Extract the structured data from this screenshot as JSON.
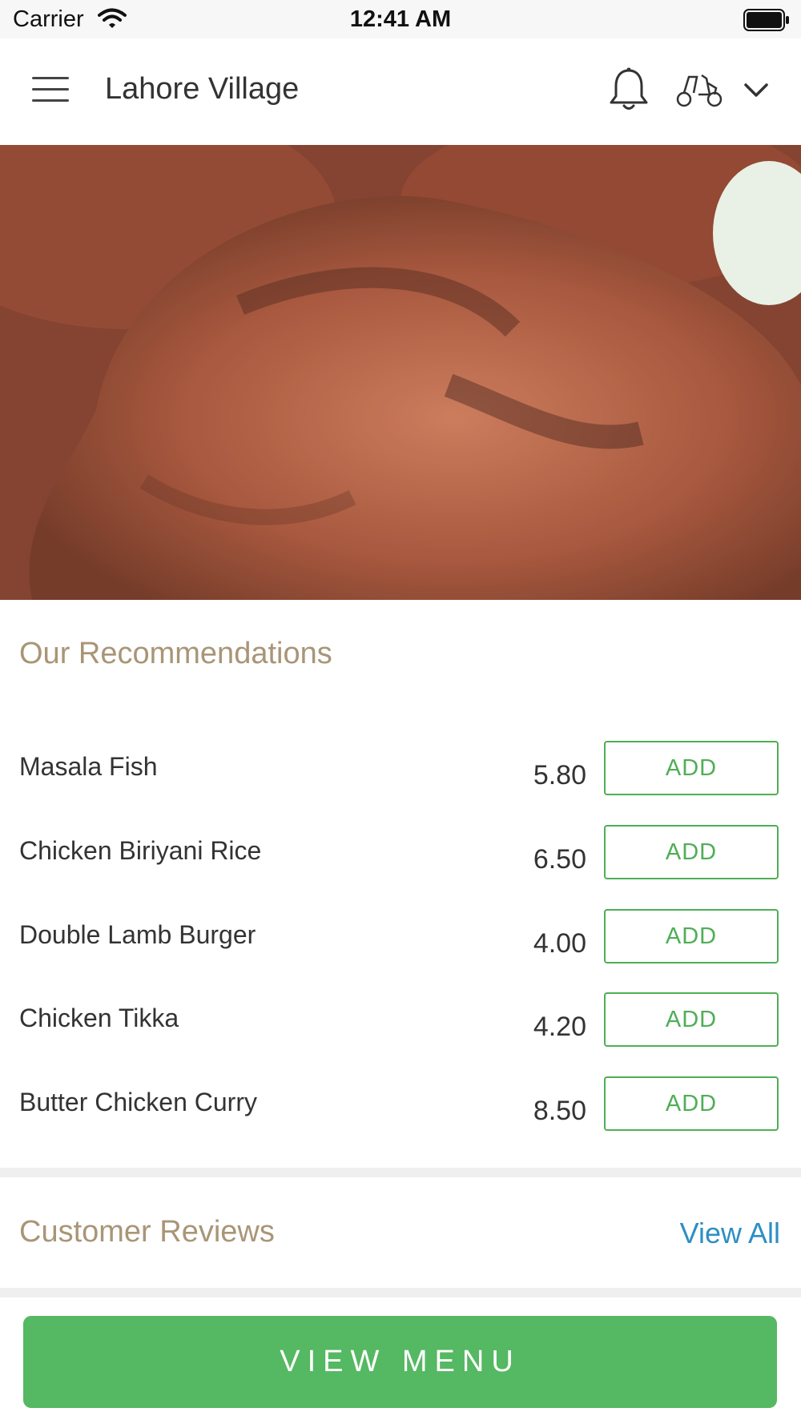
{
  "status_bar": {
    "carrier": "Carrier",
    "time": "12:41 AM"
  },
  "header": {
    "title": "Lahore Village"
  },
  "recommendations": {
    "title": "Our Recommendations",
    "items": [
      {
        "name": "Masala Fish",
        "price": "5.80",
        "button": "ADD"
      },
      {
        "name": "Chicken Biriyani Rice",
        "price": "6.50",
        "button": "ADD"
      },
      {
        "name": "Double Lamb Burger",
        "price": "4.00",
        "button": "ADD"
      },
      {
        "name": "Chicken Tikka",
        "price": "4.20",
        "button": "ADD"
      },
      {
        "name": "Butter Chicken Curry",
        "price": "8.50",
        "button": "ADD"
      }
    ]
  },
  "reviews": {
    "title": "Customer Reviews",
    "view_all": "View All"
  },
  "footer": {
    "view_menu": "VIEW MENU"
  },
  "colors": {
    "accent_green": "#55b862",
    "section_title": "#a99577",
    "link_blue": "#2d8fc4"
  }
}
